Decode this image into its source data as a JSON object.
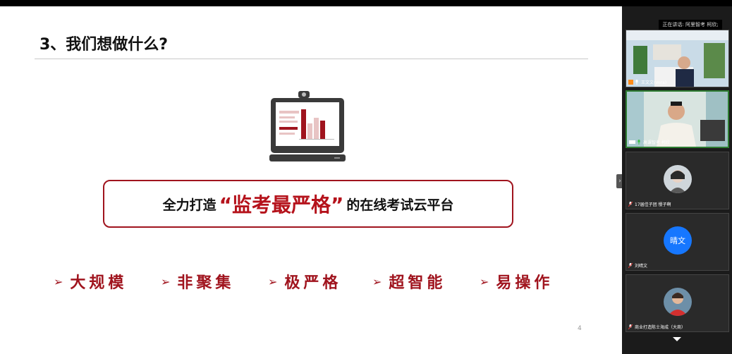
{
  "slide": {
    "title": "3、我们想做什么?",
    "slogan": {
      "before": "全力打造",
      "highlight": "“监考最严格”",
      "after": "的在线考试云平台"
    },
    "features": [
      "大规模",
      "非聚集",
      "极严格",
      "超智能",
      "易操作"
    ],
    "feature_arrow": "➢",
    "page_number": "4",
    "accent_color": "#a0141e"
  },
  "sidebar": {
    "speaking": "正在讲话: 阿里智考 柯欣;",
    "tiles": [
      {
        "name": "王文文(Vera)",
        "active": false
      },
      {
        "name": "高课智考 柯欣",
        "active": true
      },
      {
        "name": "17届佳子团 慢子啊",
        "active": false
      },
      {
        "name": "刘晴文",
        "active": false,
        "avatar_text": "晴文"
      },
      {
        "name": "商业打造陈士海成（大商）",
        "active": false
      }
    ],
    "collapse_glyph": "›"
  }
}
